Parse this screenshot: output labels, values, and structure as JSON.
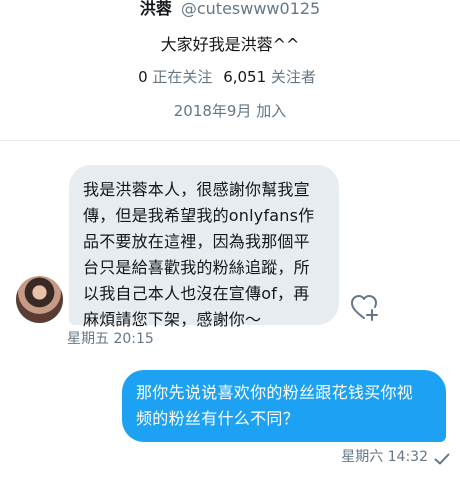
{
  "profile": {
    "name": "洪蓉",
    "handle": "@cuteswww0125",
    "bio": "大家好我是洪蓉^^",
    "following_count": "0",
    "following_label": "正在关注",
    "followers_count": "6,051",
    "followers_label": "关注者",
    "joined": "2018年9月 加入"
  },
  "messages": {
    "incoming": {
      "text": "我是洪蓉本人，很感謝你幫我宣\n傳，但是我希望我的onlyfans作\n品不要放在這裡，因為我那個平\n台只是給喜歡我的粉絲追蹤，所\n以我自己本人也沒在宣傳of，再\n麻煩請您下架，感謝你～",
      "time": "星期五 20:15"
    },
    "outgoing": {
      "text": "那你先说说喜欢你的粉丝跟花钱买你视\n频的粉丝有什么不同？",
      "time": "星期六 14:32"
    }
  },
  "icons": {
    "like": "heart-plus-icon",
    "read": "check-icon"
  },
  "colors": {
    "accent": "#1da1f2",
    "bubble_in": "#e6ecf0",
    "muted": "#657786"
  }
}
